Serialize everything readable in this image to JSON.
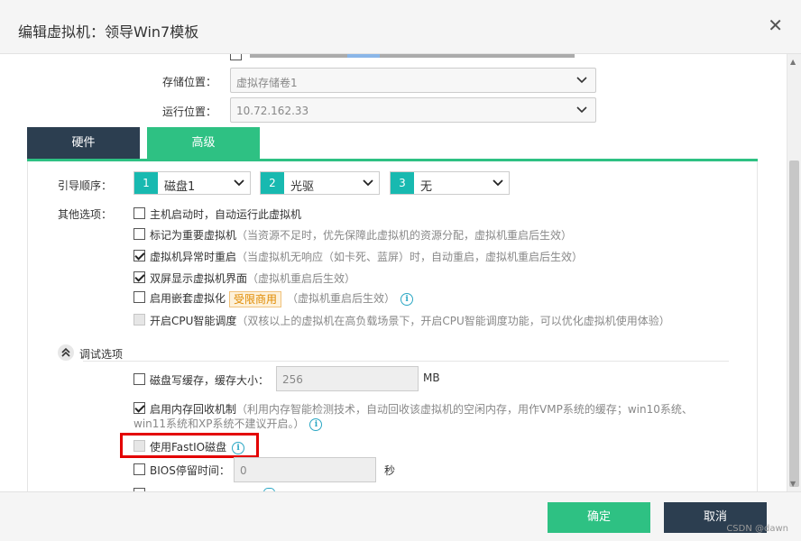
{
  "dialog": {
    "title": "编辑虚拟机：领导Win7模板",
    "close": "✕"
  },
  "storage": {
    "label": "存储位置：",
    "value": "虚拟存储卷1"
  },
  "run": {
    "label": "运行位置：",
    "value": "10.72.162.33"
  },
  "tabs": [
    {
      "label": "硬件"
    },
    {
      "label": "高级"
    }
  ],
  "boot": {
    "label": "引导顺序：",
    "items": [
      {
        "num": "1",
        "value": "磁盘1"
      },
      {
        "num": "2",
        "value": "光驱"
      },
      {
        "num": "3",
        "value": "无"
      }
    ]
  },
  "other": {
    "label": "其他选项：",
    "options": [
      {
        "text": "主机启动时，自动运行此虚拟机",
        "hint": "",
        "checked": false
      },
      {
        "text": "标记为重要虚拟机",
        "hint": "（当资源不足时，优先保障此虚拟机的资源分配，虚拟机重启后生效）",
        "checked": false
      },
      {
        "text": "虚拟机异常时重启",
        "hint": "（当虚拟机无响应（如卡死、蓝屏）时，自动重启，虚拟机重启后生效）",
        "checked": true
      },
      {
        "text": "双屏显示虚拟机界面",
        "hint": "（虚拟机重启后生效）",
        "checked": true
      },
      {
        "text": "启用嵌套虚拟化",
        "badge": "受限商用",
        "hint": "（虚拟机重启后生效）",
        "checked": false
      },
      {
        "text": "开启CPU智能调度",
        "hint": "（双核以上的虚拟机在高负载场景下，开启CPU智能调度功能，可以优化虚拟机使用体验）",
        "checked": false
      }
    ]
  },
  "debug": {
    "title": "调试选项",
    "disk_cache": {
      "text": "磁盘写缓存，缓存大小：",
      "value": "256",
      "unit": "MB"
    },
    "mem_reclaim": {
      "text": "启用内存回收机制",
      "hint1": "（利用内存智能检测技术，自动回收该虚拟机的空闲内存，用作VMP系统的缓存；win10系统、",
      "hint2": "win11系统和XP系统不建议开启。）"
    },
    "fastio": {
      "text": "使用FastIO磁盘"
    },
    "bios": {
      "text": "BIOS停留时间：",
      "value": "0",
      "unit": "秒"
    }
  },
  "footer": {
    "ok": "确定",
    "cancel": "取消",
    "watermark": "CSDN @dawn"
  },
  "colors": {
    "accent": "#2ec183",
    "dark": "#2c3e50",
    "teal": "#18b9b0",
    "highlight": "#e30000"
  }
}
